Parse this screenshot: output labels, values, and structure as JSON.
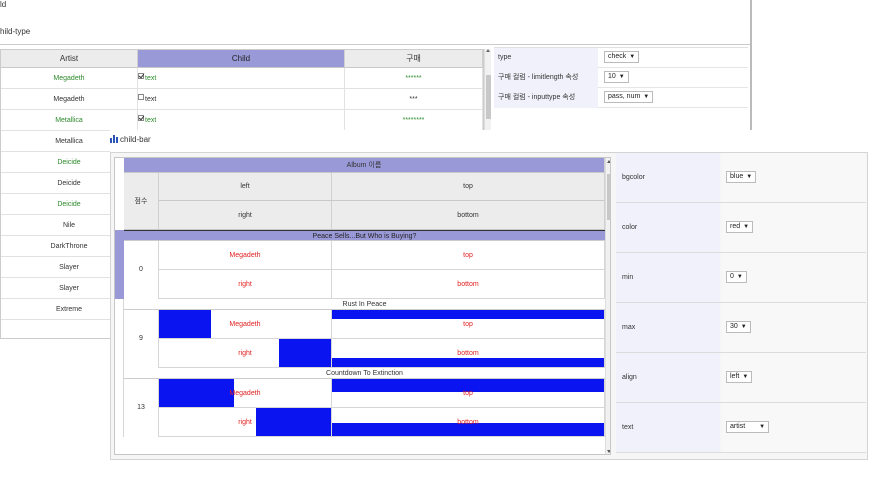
{
  "back": {
    "top_title": "ld",
    "sub_title": "hild-type",
    "headers": [
      "Artist",
      "Child",
      "구매"
    ],
    "rows": [
      {
        "artist": "Megadeth",
        "checked": true,
        "child": "text",
        "buy": "******",
        "green": true
      },
      {
        "artist": "Megadeth",
        "checked": false,
        "child": "text",
        "buy": "***",
        "green": false
      },
      {
        "artist": "Metallica",
        "checked": true,
        "child": "text",
        "buy": "********",
        "green": true
      },
      {
        "artist": "Metallica",
        "green": false
      },
      {
        "artist": "Deicide",
        "green": true
      },
      {
        "artist": "Deicide",
        "green": false
      },
      {
        "artist": "Deicide",
        "green": true
      },
      {
        "artist": "Nile",
        "green": false
      },
      {
        "artist": "DarkThrone",
        "green": false
      },
      {
        "artist": "Slayer",
        "green": false
      },
      {
        "artist": "Slayer",
        "green": false
      },
      {
        "artist": "Extreme",
        "green": false
      }
    ],
    "props": [
      {
        "key": "type",
        "value": "check"
      },
      {
        "key": "구매 컬럼 - limitlength 속성",
        "value": "10"
      },
      {
        "key": "구매 컬럼 - inputtype 속성",
        "value": "pass, num"
      }
    ]
  },
  "front": {
    "title": "child-bar",
    "header": {
      "album": "Album 이름",
      "score": "점수",
      "left": "left",
      "top": "top",
      "right": "right",
      "bottom": "bottom"
    },
    "groups": [
      {
        "name": "Peace Sells...But Who is Buying?",
        "score": "0",
        "left": "Megadeth",
        "top": "top",
        "right": "right",
        "bottom": "bottom",
        "level": 0,
        "selected": true
      },
      {
        "name": "Rust In Peace",
        "score": "9",
        "left": "Megadeth",
        "top": "top",
        "right": "right",
        "bottom": "bottom",
        "level": 0.3,
        "selected": false
      },
      {
        "name": "Countdown To Extinction",
        "score": "13",
        "left": "Megadeth",
        "top": "top",
        "right": "right",
        "bottom": "bottom",
        "level": 0.4333,
        "selected": false
      }
    ],
    "props": [
      {
        "key": "bgcolor",
        "value": "blue"
      },
      {
        "key": "color",
        "value": "red"
      },
      {
        "key": "min",
        "value": "0"
      },
      {
        "key": "max",
        "value": "30"
      },
      {
        "key": "align",
        "value": "left"
      },
      {
        "key": "text",
        "value": "artist"
      }
    ]
  },
  "colors": {
    "bar": "#0a14f0",
    "selection": "#9999d8",
    "text_red": "#e02020",
    "text_green": "#2c8a2c"
  }
}
